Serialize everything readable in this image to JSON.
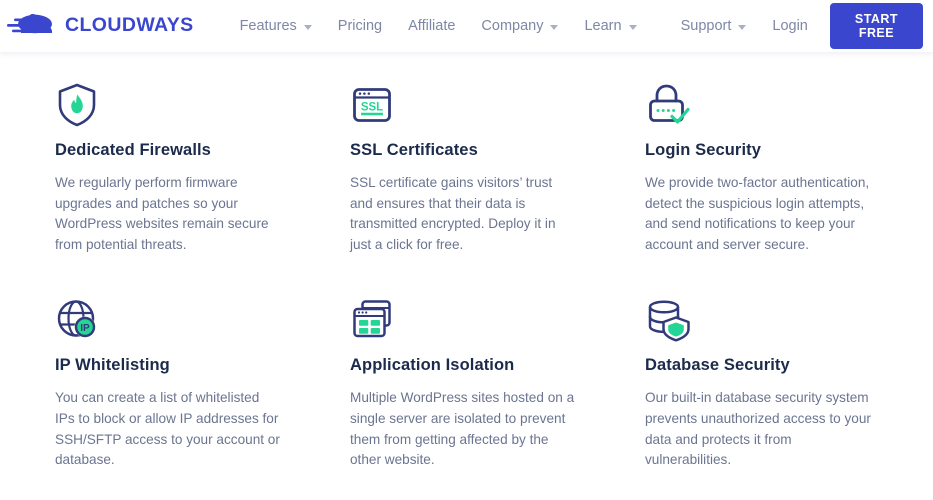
{
  "brand": {
    "logo_text": "CLOUDWAYS",
    "logo_icon": "cloud-speed-icon",
    "logo_color": "#3b46cf"
  },
  "nav": {
    "items": [
      {
        "label": "Features",
        "has_dropdown": true,
        "icon": "chevron-down-icon"
      },
      {
        "label": "Pricing",
        "has_dropdown": false,
        "icon": ""
      },
      {
        "label": "Affiliate",
        "has_dropdown": false,
        "icon": ""
      },
      {
        "label": "Company",
        "has_dropdown": true,
        "icon": "chevron-down-icon"
      },
      {
        "label": "Learn",
        "has_dropdown": true,
        "icon": "chevron-down-icon"
      },
      {
        "label": "Support",
        "has_dropdown": true,
        "icon": "chevron-down-icon"
      }
    ],
    "login_label": "Login",
    "cta_label": "START FREE",
    "cta_color": "#3b46cf",
    "link_color": "#7e87a6"
  },
  "features": {
    "accent_color": "#25d596",
    "icon_color": "#313b7a",
    "title_color": "#1c2b4b",
    "body_color": "#6b7590",
    "cards": [
      {
        "icon": "shield-flame-icon",
        "title": "Dedicated Firewalls",
        "body": "We regularly perform firmware upgrades and patches so your WordPress websites remain secure from potential threats."
      },
      {
        "icon": "ssl-browser-icon",
        "icon_label": "SSL",
        "title": "SSL Certificates",
        "body": "SSL certificate gains visitors’ trust and ensures that their data is transmitted encrypted. Deploy it in just a click for free."
      },
      {
        "icon": "padlock-check-icon",
        "title": "Login Security",
        "body": "We provide two-factor authentication, detect the suspicious login attempts, and send notifications to keep your account and server secure."
      },
      {
        "icon": "globe-ip-icon",
        "icon_label": "IP",
        "title": "IP Whitelisting",
        "body": "You can create a list of whitelisted IPs to block or allow IP addresses for SSH/SFTP access to your account or database."
      },
      {
        "icon": "stacked-windows-icon",
        "title": "Application Isolation",
        "body": "Multiple WordPress sites hosted on a single server are isolated to prevent them from getting affected by the other website."
      },
      {
        "icon": "database-shield-icon",
        "title": "Database Security",
        "body": "Our built-in database security system prevents unauthorized access to your data and protects it from vulnerabilities."
      }
    ]
  }
}
